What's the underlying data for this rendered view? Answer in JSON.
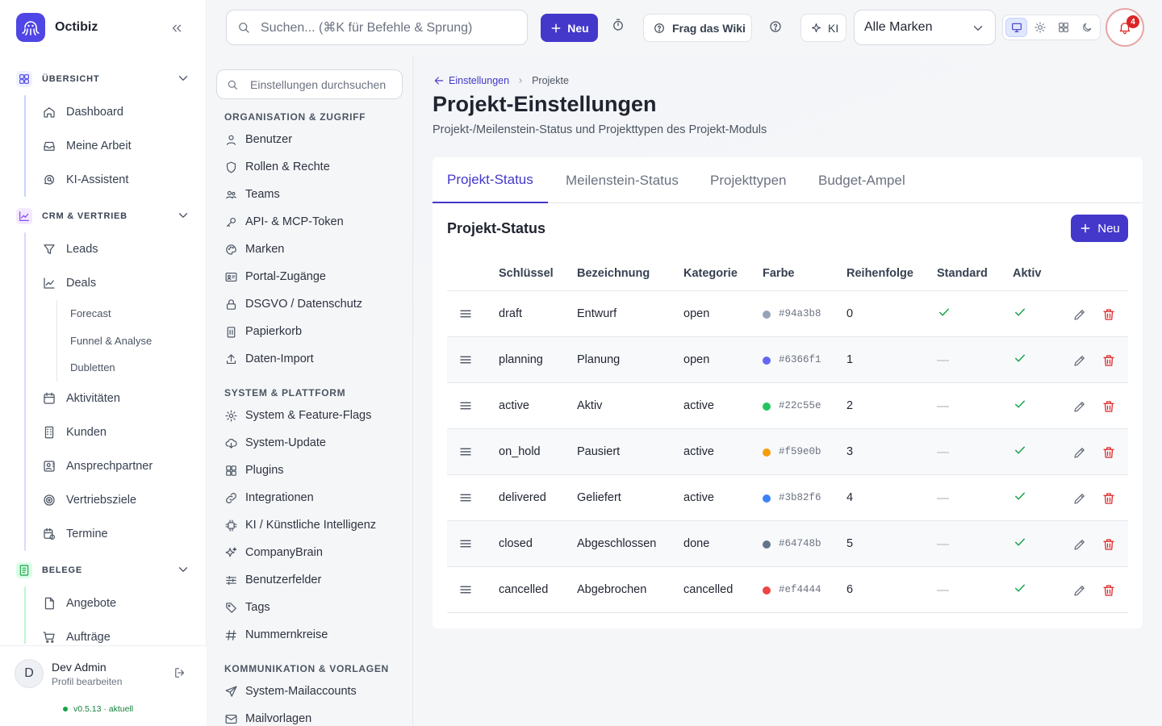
{
  "app": {
    "name": "Octibiz",
    "version": "v0.5.13",
    "version_status": "· aktuell"
  },
  "sidebar": {
    "sections": [
      {
        "label": "ÜBERSICHT",
        "color": "#4f46e5",
        "items": [
          {
            "label": "Dashboard",
            "icon": "home-icon"
          },
          {
            "label": "Meine Arbeit",
            "icon": "inbox-icon"
          },
          {
            "label": "KI-Assistent",
            "icon": "chat-search-icon"
          }
        ]
      },
      {
        "label": "CRM & VERTRIEB",
        "color": "#7c3aed",
        "items": [
          {
            "label": "Leads",
            "icon": "filter-icon"
          },
          {
            "label": "Deals",
            "icon": "chart-line-icon"
          },
          {
            "label": "Aktivitäten",
            "icon": "calendar-icon"
          },
          {
            "label": "Kunden",
            "icon": "building-icon"
          },
          {
            "label": "Ansprechpartner",
            "icon": "contact-card-icon"
          },
          {
            "label": "Vertriebsziele",
            "icon": "target-icon"
          },
          {
            "label": "Termine",
            "icon": "calendar-clock-icon"
          }
        ],
        "deals_sub": [
          "Forecast",
          "Funnel & Analyse",
          "Dubletten"
        ]
      },
      {
        "label": "BELEGE",
        "color": "#16a34a",
        "items": [
          {
            "label": "Angebote",
            "icon": "document-icon"
          },
          {
            "label": "Aufträge",
            "icon": "cart-icon"
          }
        ]
      }
    ],
    "user": {
      "initial": "D",
      "name": "Dev Admin",
      "profile_link": "Profil bearbeiten"
    }
  },
  "topbar": {
    "search_placeholder": "Suchen... (⌘K für Befehle & Sprung)",
    "new_label": "Neu",
    "wiki_label": "Frag das Wiki",
    "ki_label": "KI",
    "brand_select": "Alle Marken",
    "notifications_count": "4"
  },
  "settings_nav": {
    "search_placeholder": "Einstellungen durchsuchen",
    "groups": [
      {
        "heading": "ORGANISATION & ZUGRIFF",
        "items": [
          {
            "label": "Benutzer",
            "icon": "user-icon"
          },
          {
            "label": "Rollen & Rechte",
            "icon": "shield-icon"
          },
          {
            "label": "Teams",
            "icon": "users-icon"
          },
          {
            "label": "API- & MCP-Token",
            "icon": "key-icon"
          },
          {
            "label": "Marken",
            "icon": "palette-icon"
          },
          {
            "label": "Portal-Zugänge",
            "icon": "id-card-icon"
          },
          {
            "label": "DSGVO / Datenschutz",
            "icon": "lock-icon"
          },
          {
            "label": "Papierkorb",
            "icon": "trash-icon"
          },
          {
            "label": "Daten-Import",
            "icon": "upload-icon"
          }
        ]
      },
      {
        "heading": "SYSTEM & PLATTFORM",
        "items": [
          {
            "label": "System & Feature-Flags",
            "icon": "gear-icon"
          },
          {
            "label": "System-Update",
            "icon": "cloud-download-icon"
          },
          {
            "label": "Plugins",
            "icon": "grid-icon"
          },
          {
            "label": "Integrationen",
            "icon": "link-icon"
          },
          {
            "label": "KI / Künstliche Intelligenz",
            "icon": "chip-icon"
          },
          {
            "label": "CompanyBrain",
            "icon": "sparkles-icon"
          },
          {
            "label": "Benutzerfelder",
            "icon": "sliders-icon"
          },
          {
            "label": "Tags",
            "icon": "tag-icon"
          },
          {
            "label": "Nummernkreise",
            "icon": "hash-icon"
          }
        ]
      },
      {
        "heading": "KOMMUNIKATION & VORLAGEN",
        "items": [
          {
            "label": "System-Mailaccounts",
            "icon": "send-icon"
          },
          {
            "label": "Mailvorlagen",
            "icon": "mail-icon"
          }
        ]
      }
    ]
  },
  "main": {
    "breadcrumb_back": "Einstellungen",
    "breadcrumb_current": "Projekte",
    "title": "Projekt-Einstellungen",
    "subtitle": "Projekt-/Meilenstein-Status und Projekttypen des Projekt-Moduls",
    "tabs": [
      "Projekt-Status",
      "Meilenstein-Status",
      "Projekttypen",
      "Budget-Ampel"
    ],
    "active_tab": "Projekt-Status",
    "section_title": "Projekt-Status",
    "new_label": "Neu",
    "columns": [
      "Schlüssel",
      "Bezeichnung",
      "Kategorie",
      "Farbe",
      "Reihenfolge",
      "Standard",
      "Aktiv"
    ],
    "rows": [
      {
        "key": "draft",
        "name": "Entwurf",
        "category": "open",
        "color": "#94a3b8",
        "order": "0",
        "standard": true,
        "active": true
      },
      {
        "key": "planning",
        "name": "Planung",
        "category": "open",
        "color": "#6366f1",
        "order": "1",
        "standard": false,
        "active": true
      },
      {
        "key": "active",
        "name": "Aktiv",
        "category": "active",
        "color": "#22c55e",
        "order": "2",
        "standard": false,
        "active": true
      },
      {
        "key": "on_hold",
        "name": "Pausiert",
        "category": "active",
        "color": "#f59e0b",
        "order": "3",
        "standard": false,
        "active": true
      },
      {
        "key": "delivered",
        "name": "Geliefert",
        "category": "active",
        "color": "#3b82f6",
        "order": "4",
        "standard": false,
        "active": true
      },
      {
        "key": "closed",
        "name": "Abgeschlossen",
        "category": "done",
        "color": "#64748b",
        "order": "5",
        "standard": false,
        "active": true
      },
      {
        "key": "cancelled",
        "name": "Abgebrochen",
        "category": "cancelled",
        "color": "#ef4444",
        "order": "6",
        "standard": false,
        "active": true
      }
    ]
  }
}
